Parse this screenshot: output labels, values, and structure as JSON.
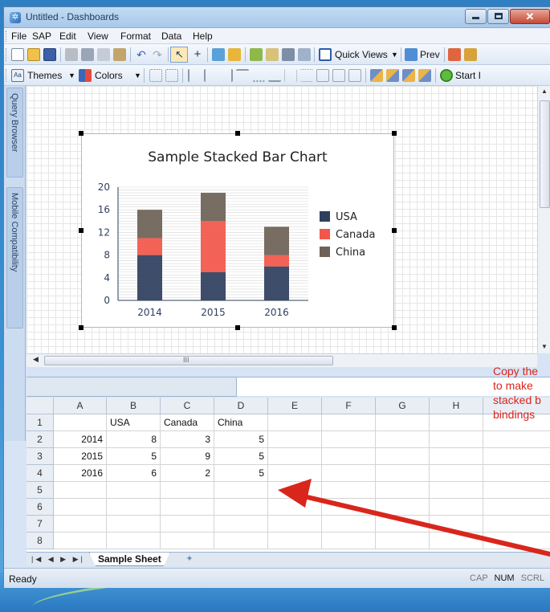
{
  "window": {
    "title": "Untitled - Dashboards",
    "app_icon": "dashboards-icon"
  },
  "menu": [
    "File",
    "SAP",
    "Edit",
    "View",
    "Format",
    "Data",
    "Help"
  ],
  "toolbar1": {
    "quick_views": "Quick Views",
    "preview": "Prev"
  },
  "toolbar2": {
    "themes": "Themes",
    "colors": "Colors",
    "start": "Start I"
  },
  "side_tabs": [
    "Query Browser",
    "Mobile Compatibility"
  ],
  "chart_data": {
    "type": "bar",
    "stacked": true,
    "title": "Sample Stacked Bar Chart",
    "categories": [
      "2014",
      "2015",
      "2016"
    ],
    "series": [
      {
        "name": "USA",
        "values": [
          8,
          5,
          6
        ],
        "color": "#2f3f5e"
      },
      {
        "name": "Canada",
        "values": [
          3,
          9,
          2
        ],
        "color": "#f2574a"
      },
      {
        "name": "China",
        "values": [
          5,
          5,
          5
        ],
        "color": "#6e6256"
      }
    ],
    "ylim": [
      0,
      20
    ],
    "yticks": [
      "0",
      "4",
      "8",
      "12",
      "16",
      "20"
    ],
    "legend": "right",
    "grid": true
  },
  "hscroll_label": "III",
  "spreadsheet": {
    "columns": [
      "A",
      "B",
      "C",
      "D",
      "E",
      "F",
      "G",
      "H"
    ],
    "rows": [
      [
        "",
        "USA",
        "Canada",
        "China"
      ],
      [
        "2014",
        "8",
        "3",
        "5"
      ],
      [
        "2015",
        "5",
        "9",
        "5"
      ],
      [
        "2016",
        "6",
        "2",
        "5"
      ],
      [],
      [],
      [],
      []
    ],
    "row_numbers": [
      "1",
      "2",
      "3",
      "4",
      "5",
      "6",
      "7",
      "8"
    ]
  },
  "sheet_tab": "Sample Sheet",
  "status": {
    "ready": "Ready",
    "keys": [
      "CAP",
      "NUM",
      "SCRL"
    ],
    "active_key": "NUM"
  },
  "note_lines": [
    "Copy the",
    "to make",
    "stacked b",
    "bindings"
  ],
  "colors": {
    "annotation": "#d9261c",
    "accent": "#2f7fc3"
  }
}
